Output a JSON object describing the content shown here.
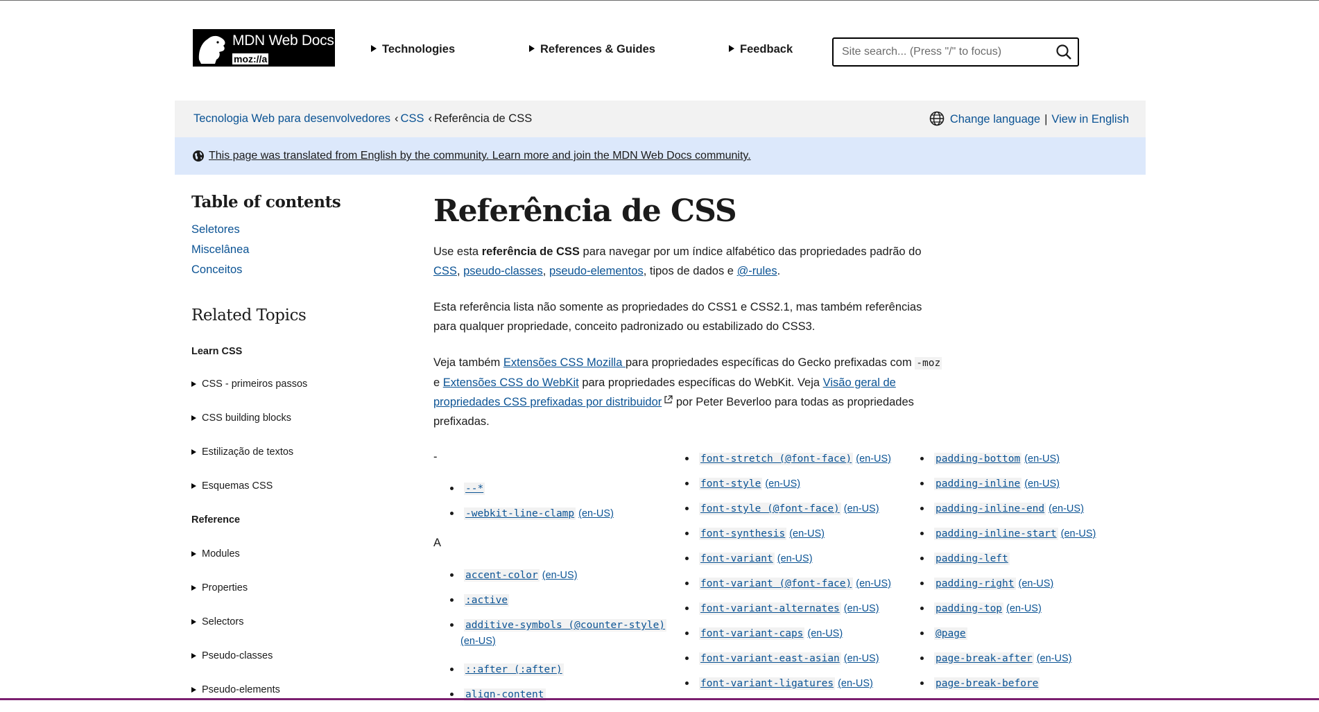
{
  "header": {
    "logo_title": "MDN Web Docs",
    "logo_moz": "moz://a",
    "nav": [
      "Technologies",
      "References & Guides",
      "Feedback"
    ],
    "search_placeholder": "Site search... (Press \"/\" to focus)"
  },
  "breadcrumb": {
    "items": [
      "Tecnologia Web para desenvolvedores",
      "CSS",
      "Referência de CSS"
    ],
    "change_language": "Change language",
    "view_in_english": "View in English"
  },
  "notice": {
    "text": "This page was translated from English by the community. Learn more and join the MDN Web Docs community."
  },
  "sidebar": {
    "toc_title": "Table of contents",
    "toc": [
      "Seletores",
      "Miscelânea",
      "Conceitos"
    ],
    "related_title": "Related Topics",
    "learn_heading": "Learn CSS",
    "learn_items": [
      "CSS - primeiros passos",
      "CSS building blocks",
      "Estilização de textos",
      "Esquemas CSS"
    ],
    "reference_heading": "Reference",
    "reference_items": [
      "Modules",
      "Properties",
      "Selectors",
      "Pseudo-classes",
      "Pseudo-elements"
    ]
  },
  "main": {
    "title": "Referência de CSS",
    "p1": {
      "t1": "Use esta ",
      "b1": "referência de CSS",
      "t2": " para navegar por um índice alfabético das propriedades padrão do ",
      "l1": "CSS",
      "t3": ", ",
      "l2": "pseudo-classes",
      "t4": ", ",
      "l3": "pseudo-elementos",
      "t5": ", tipos de dados e ",
      "l4": "@-rules",
      "t6": "."
    },
    "p2": "Esta referência lista não somente as propriedades do CSS1 e CSS2.1, mas também referências para qualquer propriedade, conceito padronizado ou estabilizado do CSS3.",
    "p3": {
      "t1": "Veja também ",
      "l1": "Extensões CSS Mozilla ",
      "t2": "para propriedades específicas do Gecko prefixadas com ",
      "c1": "-moz",
      "t3": " e ",
      "l2": "Extensões CSS do WebKit",
      "t4": " para propriedades específicas do WebKit. Veja ",
      "l3": "Visão geral de propriedades CSS prefixadas por distribuidor",
      "t5": " por Peter Beverloo para todas as propriedades prefixadas."
    }
  },
  "index": {
    "letter_dash": "-",
    "letter_a": "A",
    "enus": "(en-US)",
    "dash_items": [
      {
        "code": "--*",
        "enus": false
      },
      {
        "code": "-webkit-line-clamp",
        "enus": true
      }
    ],
    "a_items": [
      {
        "code": "accent-color",
        "enus": true
      },
      {
        "code": ":active",
        "enus": false
      },
      {
        "code": "additive-symbols (@counter-style)",
        "enus": false
      },
      {
        "code": "::after (:after)",
        "enus": false
      },
      {
        "code": "align-content",
        "enus": false
      }
    ],
    "col2": [
      {
        "code": "font-stretch (@font-face)",
        "enus": true
      },
      {
        "code": "font-style",
        "enus": true
      },
      {
        "code": "font-style (@font-face)",
        "enus": true
      },
      {
        "code": "font-synthesis",
        "enus": true
      },
      {
        "code": "font-variant",
        "enus": true
      },
      {
        "code": "font-variant (@font-face)",
        "enus": true
      },
      {
        "code": "font-variant-alternates",
        "enus": true
      },
      {
        "code": "font-variant-caps",
        "enus": true
      },
      {
        "code": "font-variant-east-asian",
        "enus": true
      },
      {
        "code": "font-variant-ligatures",
        "enus": true
      }
    ],
    "col3": [
      {
        "code": "padding-bottom",
        "enus": true
      },
      {
        "code": "padding-inline",
        "enus": true
      },
      {
        "code": "padding-inline-end",
        "enus": true
      },
      {
        "code": "padding-inline-start",
        "enus": true
      },
      {
        "code": "padding-left",
        "enus": false
      },
      {
        "code": "padding-right",
        "enus": true
      },
      {
        "code": "padding-top",
        "enus": true
      },
      {
        "code": "@page",
        "enus": false
      },
      {
        "code": "page-break-after",
        "enus": true
      },
      {
        "code": "page-break-before",
        "enus": false
      }
    ]
  }
}
